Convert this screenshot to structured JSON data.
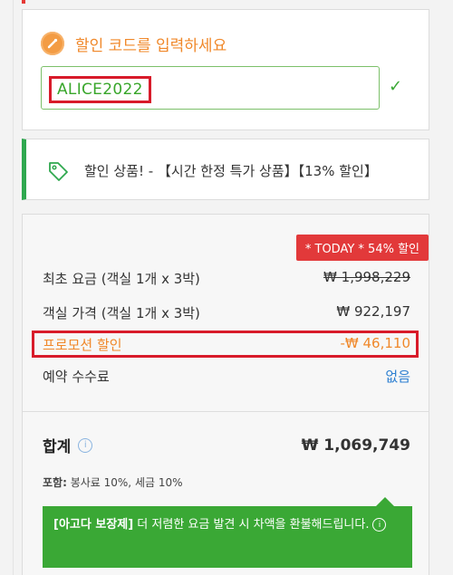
{
  "promo": {
    "title": "할인 코드를 입력하세요",
    "code_value": "ALICE2022",
    "check_icon": "check-icon"
  },
  "deal": {
    "text": "할인 상품! - 【시간 한정 특가 상품】【13% 할인】"
  },
  "price": {
    "badge": "* TODAY * 54% 할인",
    "rows": [
      {
        "label": "최초 요금 (객실 1개 x 3박)",
        "value": "₩ 1,998,229"
      },
      {
        "label": "객실 가격 (객실 1개 x 3박)",
        "value": "₩ 922,197"
      },
      {
        "label": "프로모션 할인",
        "value": "-₩ 46,110"
      },
      {
        "label": "예약 수수료",
        "value": "없음"
      }
    ],
    "total_label": "합계",
    "total_value": "₩ 1,069,749",
    "includes_label": "포함:",
    "includes_text": " 봉사료 10%, 세금 10%",
    "guarantee_bracket": "[아고다 보장제]",
    "guarantee_text": " 더 저렴한 요금 발견 시 차액을 환불해드립니다."
  },
  "colors": {
    "accent_orange": "#f0882a",
    "accent_green": "#3aa835",
    "accent_red": "#e2393a",
    "link_blue": "#2c7fd1"
  }
}
